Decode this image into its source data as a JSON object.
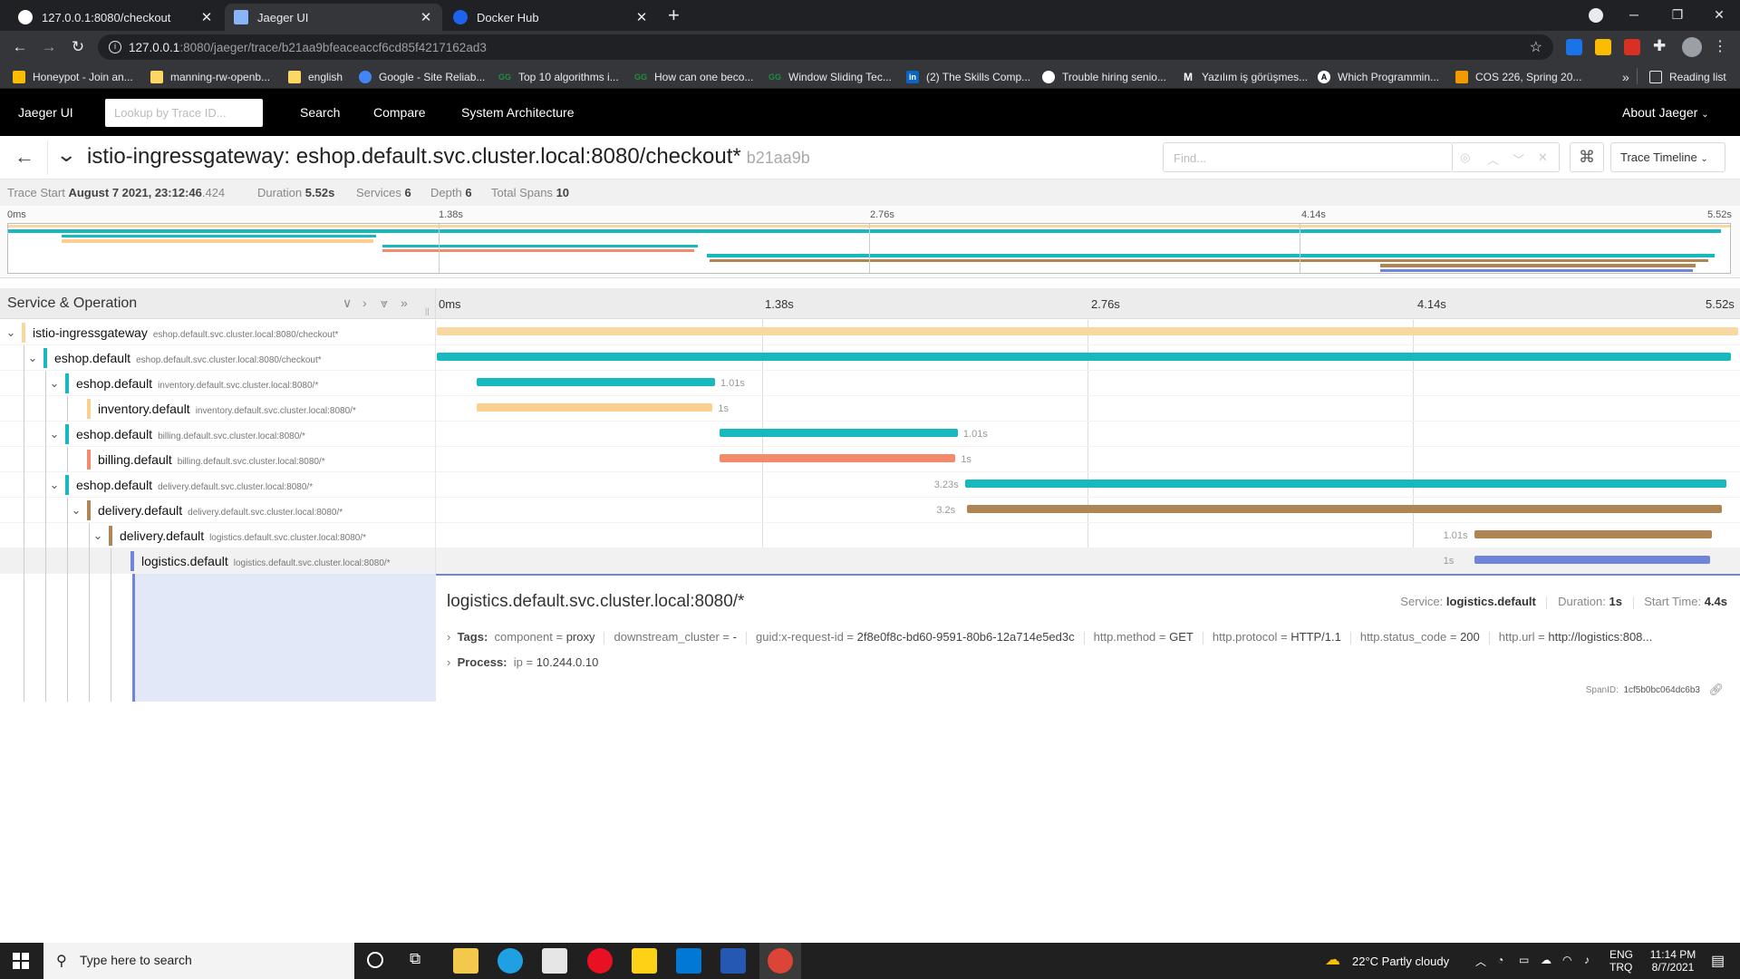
{
  "browser": {
    "tabs": [
      {
        "title": "127.0.0.1:8080/checkout",
        "active": false
      },
      {
        "title": "Jaeger UI",
        "active": true
      },
      {
        "title": "Docker Hub",
        "active": false
      }
    ],
    "new_tab": "+",
    "url_host": "127.0.0.1",
    "url_path": ":8080/jaeger/trace/b21aa9bfeaceaccf6cd85f4217162ad3",
    "bookmarks": [
      "Honeypot - Join an...",
      "manning-rw-openb...",
      "english",
      "Google - Site Reliab...",
      "Top 10 algorithms i...",
      "How can one beco...",
      "Window Sliding Tec...",
      "(2) The Skills Comp...",
      "Trouble hiring senio...",
      "Yazılım iş görüşmes...",
      "Which Programmin...",
      "COS 226, Spring 20..."
    ],
    "more": "»",
    "reading_list": "Reading list"
  },
  "jaeger_nav": {
    "brand": "Jaeger UI",
    "lookup_placeholder": "Lookup by Trace ID...",
    "search": "Search",
    "compare": "Compare",
    "system_architecture": "System Architecture",
    "about": "About Jaeger"
  },
  "trace": {
    "title": "istio-ingressgateway: eshop.default.svc.cluster.local:8080/checkout*",
    "short_id": "b21aa9b",
    "find_placeholder": "Find...",
    "view_mode": "Trace Timeline",
    "stats": {
      "trace_start_label": "Trace Start",
      "trace_start_date": "August 7 2021, 23:12:46",
      "trace_start_ms": ".424",
      "duration_label": "Duration",
      "duration": "5.52s",
      "services_label": "Services",
      "services": "6",
      "depth_label": "Depth",
      "depth": "6",
      "total_spans_label": "Total Spans",
      "total_spans": "10"
    },
    "ticks": [
      "0ms",
      "1.38s",
      "2.76s",
      "4.14s",
      "5.52s"
    ],
    "column_header": "Service & Operation",
    "total_duration_s": 5.52,
    "spans": [
      {
        "service": "istio-ingressgateway",
        "operation": "eshop.default.svc.cluster.local:8080/checkout*",
        "depth": 0,
        "color": "#f9d8a0",
        "start": 0.0,
        "end": 5.52,
        "duration": "",
        "expanded": true
      },
      {
        "service": "eshop.default",
        "operation": "eshop.default.svc.cluster.local:8080/checkout*",
        "depth": 1,
        "color": "#17b8be",
        "start": 0.0,
        "end": 5.49,
        "duration": "",
        "expanded": true
      },
      {
        "service": "eshop.default",
        "operation": "inventory.default.svc.cluster.local:8080/*",
        "depth": 2,
        "color": "#17b8be",
        "start": 0.17,
        "end": 1.18,
        "duration": "1.01s",
        "expanded": true
      },
      {
        "service": "inventory.default",
        "operation": "inventory.default.svc.cluster.local:8080/*",
        "depth": 3,
        "color": "#fccf91",
        "start": 0.17,
        "end": 1.17,
        "duration": "1s",
        "expanded": null
      },
      {
        "service": "eshop.default",
        "operation": "billing.default.svc.cluster.local:8080/*",
        "depth": 2,
        "color": "#17b8be",
        "start": 1.2,
        "end": 2.21,
        "duration": "1.01s",
        "expanded": true
      },
      {
        "service": "billing.default",
        "operation": "billing.default.svc.cluster.local:8080/*",
        "depth": 3,
        "color": "#f28a6b",
        "start": 1.2,
        "end": 2.2,
        "duration": "1s",
        "expanded": null
      },
      {
        "service": "eshop.default",
        "operation": "delivery.default.svc.cluster.local:8080/*",
        "depth": 2,
        "color": "#17b8be",
        "start": 2.24,
        "end": 5.47,
        "duration": "3.23s",
        "expanded": true
      },
      {
        "service": "delivery.default",
        "operation": "delivery.default.svc.cluster.local:8080/*",
        "depth": 3,
        "color": "#b08554",
        "start": 2.25,
        "end": 5.45,
        "duration": "3.2s",
        "expanded": true
      },
      {
        "service": "delivery.default",
        "operation": "logistics.default.svc.cluster.local:8080/*",
        "depth": 4,
        "color": "#b08554",
        "start": 4.4,
        "end": 5.41,
        "duration": "1.01s",
        "expanded": true
      },
      {
        "service": "logistics.default",
        "operation": "logistics.default.svc.cluster.local:8080/*",
        "depth": 5,
        "color": "#6f85d8",
        "start": 4.4,
        "end": 5.4,
        "duration": "1s",
        "expanded": null
      }
    ],
    "detail": {
      "operation": "logistics.default.svc.cluster.local:8080/*",
      "service_label": "Service:",
      "service": "logistics.default",
      "duration_label": "Duration:",
      "duration": "1s",
      "start_label": "Start Time:",
      "start": "4.4s",
      "tags_label": "Tags:",
      "tags": [
        {
          "k": "component",
          "v": "proxy"
        },
        {
          "k": "downstream_cluster",
          "v": "-"
        },
        {
          "k": "guid:x-request-id",
          "v": "2f8e0f8c-bd60-9591-80b6-12a714e5ed3c"
        },
        {
          "k": "http.method",
          "v": "GET"
        },
        {
          "k": "http.protocol",
          "v": "HTTP/1.1"
        },
        {
          "k": "http.status_code",
          "v": "200"
        },
        {
          "k": "http.url",
          "v": "http://logistics:808..."
        }
      ],
      "process_label": "Process:",
      "process": [
        {
          "k": "ip",
          "v": "10.244.0.10"
        }
      ],
      "span_id_label": "SpanID:",
      "span_id": "1cf5b0bc064dc6b3"
    }
  },
  "taskbar": {
    "search_placeholder": "Type here to search",
    "weather": "22°C  Partly cloudy",
    "lang1": "ENG",
    "lang2": "TRQ",
    "time": "11:14 PM",
    "date": "8/7/2021"
  }
}
